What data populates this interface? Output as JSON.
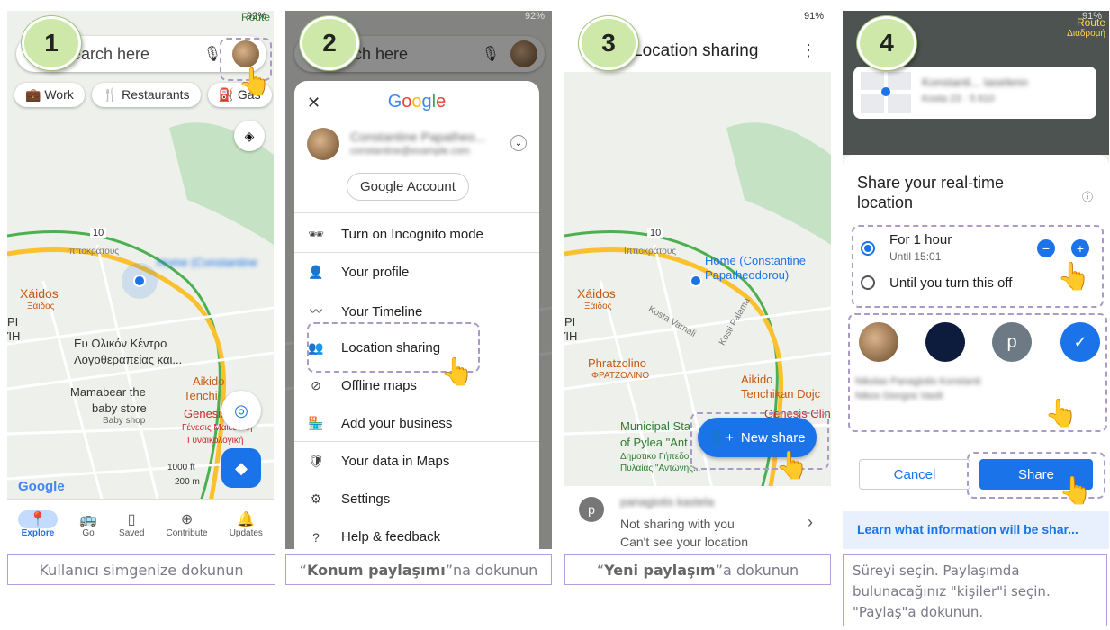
{
  "panel1": {
    "step": "1",
    "status": "92%",
    "route": "Route",
    "search_placeholder": "Search here",
    "chips": [
      "Work",
      "Restaurants",
      "Gas"
    ],
    "map_labels": {
      "xaidos": "Xáidos",
      "xaidos_gr": "Ξάιδος",
      "center": "Ευ Ολικόν Κέντρο",
      "center2": "Λογοθεραπείας και...",
      "mamabear": "Mamabear the",
      "mamabear2": "baby store",
      "babyshop": "Baby shop",
      "aikido": "Aikido",
      "tenchi": "Tenchi",
      "genesis": "Genesis",
      "genesis_gr": "Γένεσις Μαιευτική",
      "genesis_gr2": "Γυναικολογική",
      "road": "10",
      "ippokratous": "Ιπποκράτους",
      "scale_ft": "1000 ft",
      "scale_m": "200 m",
      "google": "Google",
      "pi": "ΡΙ",
      "ih": "ΊΗ"
    },
    "nav": [
      {
        "label": "Explore",
        "icon": "explore-icon"
      },
      {
        "label": "Go",
        "icon": "go-icon"
      },
      {
        "label": "Saved",
        "icon": "saved-icon"
      },
      {
        "label": "Contribute",
        "icon": "contribute-icon"
      },
      {
        "label": "Updates",
        "icon": "updates-icon"
      }
    ],
    "caption": "Kullanıcı simgenize dokunun"
  },
  "panel2": {
    "step": "2",
    "status": "92%",
    "search_placeholder": "arch here",
    "google": "Google",
    "account_button": "Google Account",
    "menu": [
      "Turn on Incognito mode",
      "Your profile",
      "Your Timeline",
      "Location sharing",
      "Offline maps",
      "Add your business",
      "Your data in Maps",
      "Settings",
      "Help & feedback"
    ],
    "caption_bold": "Konum paylaşımı",
    "caption_pre": "“",
    "caption_post": "”na dokunun"
  },
  "panel3": {
    "step": "3",
    "status": "91%",
    "title": "Location sharing",
    "map_labels": {
      "home": "Home (Constantine",
      "home2": "Papatheodorou)",
      "xaidos": "Xáidos",
      "xaidos_gr": "Ξάιδος",
      "kosta": "Kosta Varnali",
      "kosti": "Kosti Palama",
      "phratzolino": "Phratzolino",
      "phratzolino_gr": "ΦΡΑΤΖΟΛΙΝΟ",
      "aikido": "Aikido",
      "tenchikan": "Tenchikan Dojc",
      "genesis": "Genesis Clinic",
      "municipal": "Municipal Sta",
      "pylea": "of Pylea \"Ant",
      "pylea_gr": "Δημοτικό Γήπεδο",
      "pylea_gr2": "Πυλαίας \"Αντώνης...",
      "road": "10",
      "ippokratous": "Ιπποκράτους",
      "pi": "ΡΙ",
      "ih": "ΊΗ"
    },
    "new_share": "New share",
    "contact_initial": "p",
    "not_sharing": "Not sharing with you",
    "cant_see": "Can't see your location",
    "caption_bold": "Yeni paylaşım",
    "caption_pre": "“",
    "caption_post": "”a dokunun"
  },
  "panel4": {
    "step": "4",
    "status": "91%",
    "route": "Route",
    "route_gr": "Διαδρομή",
    "sheet_title": "Share your real-time location",
    "option1": "For 1 hour",
    "option1_sub": "Until 15:01",
    "option2": "Until you turn this off",
    "person_initial": "p",
    "cancel": "Cancel",
    "share": "Share",
    "learn_more": "Learn what information will be shar...",
    "caption": "Süreyi seçin. Paylaşımda bulunacağınız \"kişiler\"i seçin. \"Paylaş\"a dokunun."
  },
  "colors": {
    "accent": "#1a73e8",
    "highlight_border": "#a99bc6",
    "step_circle": "#cde8a8",
    "caption_border": "#b39ddb"
  }
}
